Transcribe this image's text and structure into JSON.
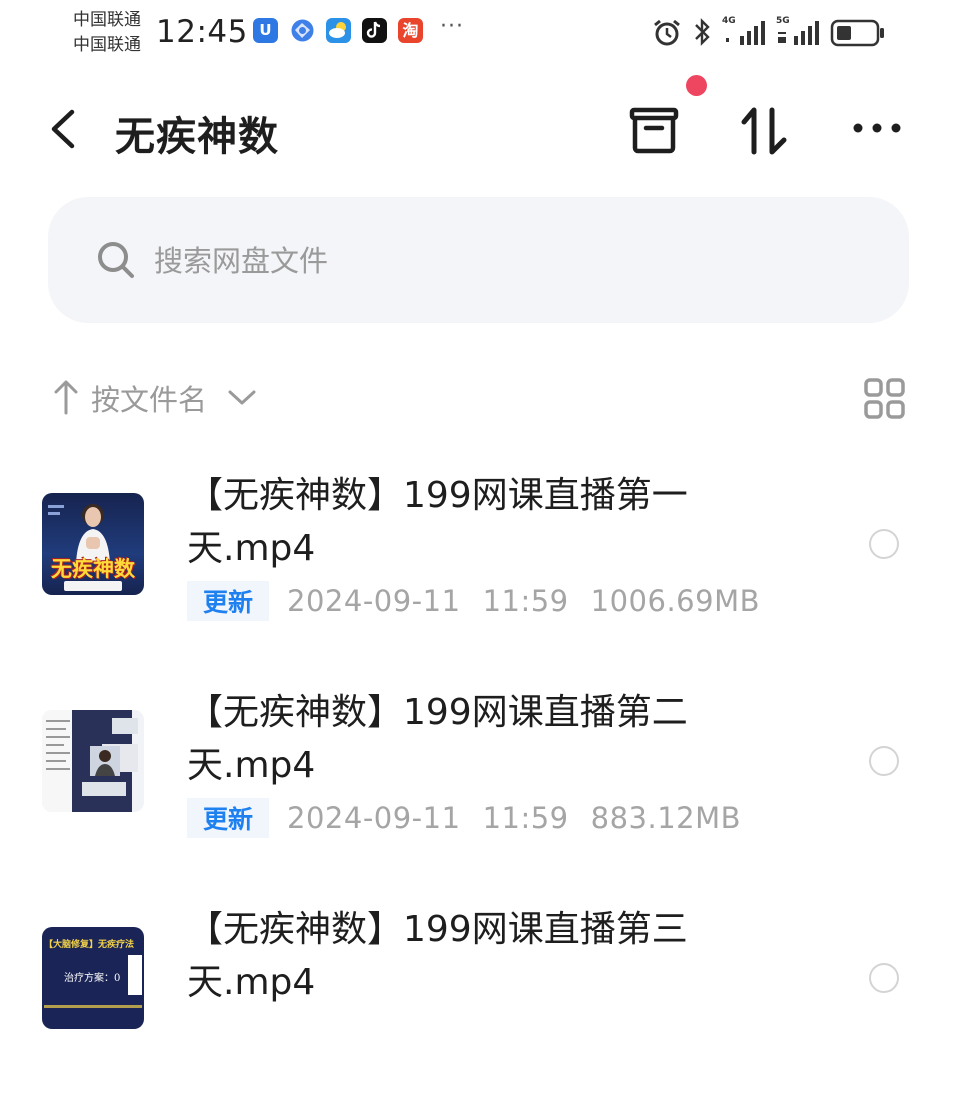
{
  "status_bar": {
    "carrier_1": "中国联通",
    "carrier_2": "中国联通",
    "time": "12:45",
    "app_icons": [
      "U",
      "taobao-char"
    ],
    "taobao_char": "淘",
    "u_char": "U",
    "more_dots": "···",
    "signal_1_label": "4G",
    "signal_2_label": "5G"
  },
  "header": {
    "title": "无疾神数",
    "has_notification_dot": true,
    "accent_red": "#ee4661"
  },
  "search": {
    "placeholder": "搜索网盘文件"
  },
  "sort": {
    "label": "按文件名"
  },
  "files": [
    {
      "name": "【无疾神数】199网课直播第一天.mp4",
      "badge": "更新",
      "date": "2024-09-11",
      "time": "11:59",
      "size": "1006.69MB",
      "thumb_text": "无疾神数"
    },
    {
      "name": "【无疾神数】199网课直播第二天.mp4",
      "badge": "更新",
      "date": "2024-09-11",
      "time": "11:59",
      "size": "883.12MB"
    },
    {
      "name": "【无疾神数】199网课直播第三天.mp4",
      "thumb_text": "【大脑修复】无疾疗法",
      "thumb_sub": "治疗方案：0"
    }
  ],
  "colors": {
    "badge_blue": "#1f80f0",
    "search_bg": "#f4f5f8",
    "meta_gray": "#a5a5a5"
  }
}
